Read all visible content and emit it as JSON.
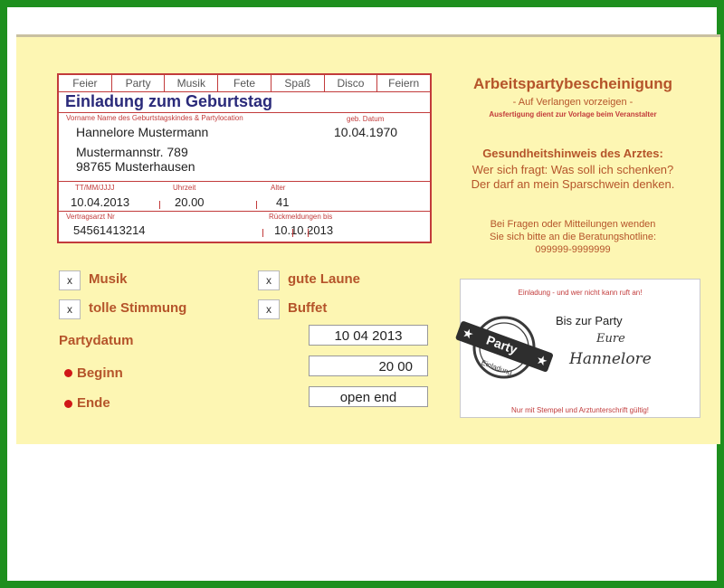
{
  "form": {
    "tabs": [
      "Feier",
      "Party",
      "Musik",
      "Fete",
      "Spaß",
      "Disco",
      "Feiern"
    ],
    "title": "Einladung zum Geburtstag",
    "name_label": "Vorname Name des Geburtstagskindes & Partylocation",
    "birth_label": "geb. Datum",
    "name": "Hannelore Mustermann",
    "birth_date": "10.04.1970",
    "street": "Mustermannstr. 789",
    "city": "98765 Musterhausen",
    "date_label": "TT/MM/JJJJ",
    "time_label": "Uhrzeit",
    "age_label": "Alter",
    "date": "10.04.2013",
    "time": "20.00",
    "age": "41",
    "doctor_label": "Vertragsarzt Nr",
    "rsvp_label": "Rückmeldungen bis",
    "doctor_nr": "54561413214",
    "rsvp_date": "10.10.2013"
  },
  "checks": [
    {
      "mark": "x",
      "label": "Musik"
    },
    {
      "mark": "x",
      "label": "gute Laune"
    },
    {
      "mark": "x",
      "label": "tolle Stimmung"
    },
    {
      "mark": "x",
      "label": "Buffet"
    }
  ],
  "party": {
    "date_label": "Partydatum",
    "date_value": "10 04 2013",
    "start_label": "Beginn",
    "start_value": "20 00",
    "end_label": "Ende",
    "end_value": "open end"
  },
  "right": {
    "title": "Arbeitspartybescheinigung",
    "sub1": "- Auf Verlangen vorzeigen -",
    "sub2": "Ausfertigung dient zur Vorlage beim Veranstalter",
    "health_title": "Gesundheitshinweis des Arztes:",
    "health_line1": "Wer sich fragt: Was soll ich schenken?",
    "health_line2": "Der darf an mein Sparschwein denken.",
    "info_line1": "Bei Fragen oder Mitteilungen wenden",
    "info_line2": "Sie sich bitte an die Beratungshotline:",
    "hotline": "099999-9999999"
  },
  "stamp_card": {
    "top_text": "Einladung - und wer nicht kann ruft an!",
    "heading": "Bis zur Party",
    "sign1": "Eure",
    "sign2": "Hannelore",
    "stamp_text": "Party",
    "stamp_ring": "Einladung",
    "footer": "Nur mit Stempel und Arztunterschrift gültig!"
  },
  "colors": {
    "accent_red": "#c23b3b",
    "heading_orange": "#b5542a",
    "card_yellow": "#fdf6b3",
    "frame_green": "#1e8f1e"
  }
}
